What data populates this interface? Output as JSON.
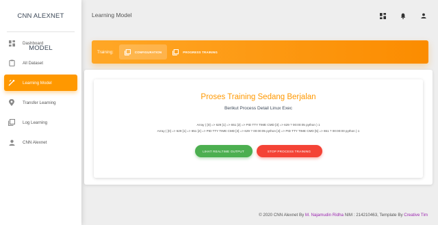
{
  "brand": "CNN ALEXNET MODEL",
  "sidebar": {
    "items": [
      {
        "label": "Dashboard",
        "icon": "dashboard-icon"
      },
      {
        "label": "All Dataset",
        "icon": "clipboard-icon"
      },
      {
        "label": "Learning Model",
        "icon": "tune-icon",
        "active": true
      },
      {
        "label": "Transfer Learning",
        "icon": "location-icon"
      },
      {
        "label": "Log Learning",
        "icon": "library-icon"
      },
      {
        "label": "CNN Alexnet",
        "icon": "person-icon"
      }
    ]
  },
  "header": {
    "title": "Learning Model",
    "icons": [
      "dashboard-icon",
      "notifications-icon",
      "person-icon"
    ]
  },
  "training": {
    "label": "Training:",
    "tabs": [
      {
        "label": "CONFIGURATION",
        "active": true
      },
      {
        "label": "PROGRESS TRAINING",
        "active": false
      }
    ]
  },
  "card": {
    "title": "Proses Training Sedang Berjalan",
    "subtitle": "Berikut Process Detail Linux Exec",
    "array_line_1": "Array ( [0] => 629 [1] => 651 [2] => PID TTY TIME CMD [3] => 629 ? 00:00:05 python ) 1",
    "array_line_2": "Array ( [0] => 629 [1] => 651 [2] => PID TTY TIME CMD [3] => 629 ? 00:00:05 python [4] => PID TTY TIME CMD [5] => 651 ? 00:00:00 python ) 1",
    "btn_realtime": "LIHAT REALTIME OUTPUT",
    "btn_stop": "STOP PROCESS TRAINING"
  },
  "footer": {
    "prefix": "© 2020 CNN Alexnet By ",
    "author": "M. Najamudin Ridha",
    "middle": " NIM : 214210463, Template By ",
    "template": "Creative Tim"
  },
  "colors": {
    "accent": "#ff9800",
    "green": "#4caf50",
    "red": "#f44336",
    "link": "#9c27b0"
  }
}
